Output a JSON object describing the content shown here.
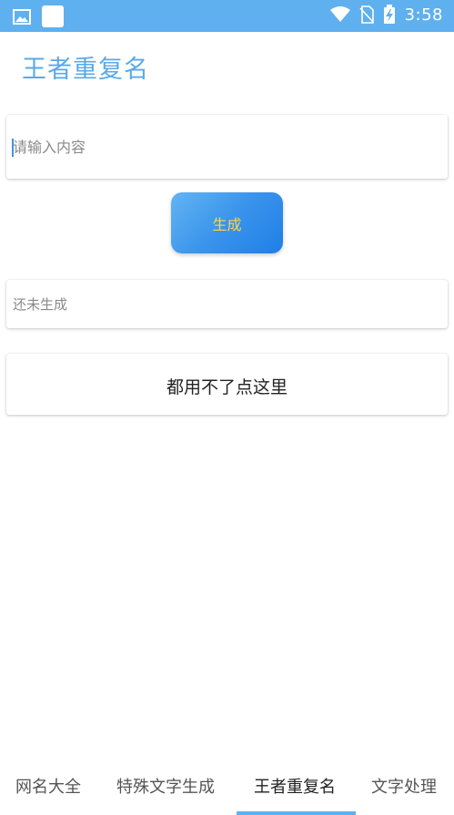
{
  "status_bar": {
    "time": "3:58",
    "icons": [
      "image-icon",
      "app-square-icon",
      "wifi-icon",
      "no-sim-icon",
      "battery-charging-icon"
    ]
  },
  "app": {
    "title": "王者重复名"
  },
  "input": {
    "placeholder": "请输入内容",
    "value": ""
  },
  "generate_button": {
    "label": "生成"
  },
  "result": {
    "text": "还未生成"
  },
  "help": {
    "label": "都用不了点这里"
  },
  "tabs": [
    {
      "label": "网名大全",
      "active": false
    },
    {
      "label": "特殊文字生成",
      "active": false
    },
    {
      "label": "王者重复名",
      "active": true
    },
    {
      "label": "文字处理",
      "active": false
    }
  ],
  "colors": {
    "status_bar": "#5fb0ef",
    "title": "#58aae8",
    "button_gradient_start": "#64b4f4",
    "button_gradient_end": "#1f7fe6",
    "button_text": "#ffd54a",
    "indicator": "#5fb0ef"
  }
}
